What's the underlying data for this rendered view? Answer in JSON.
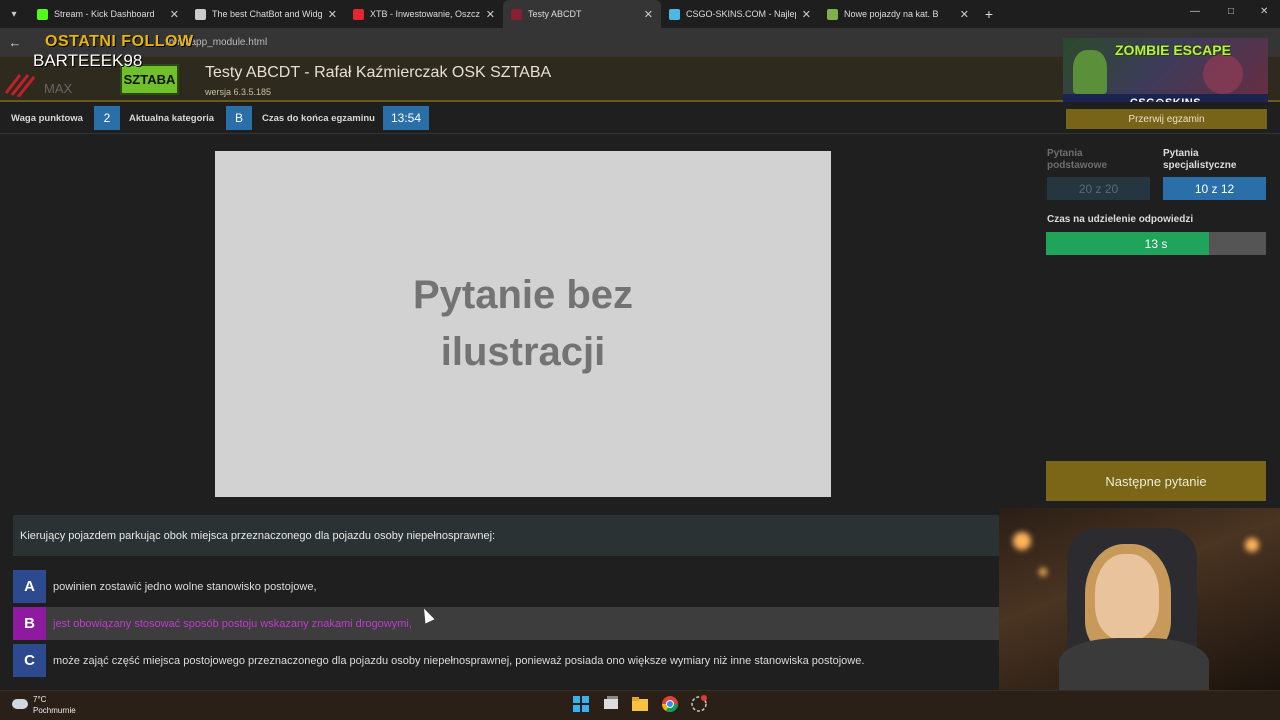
{
  "browser": {
    "tabs": [
      {
        "label": "Stream - Kick Dashboard",
        "color": "#53fc18",
        "active": false
      },
      {
        "label": "The best ChatBot and Widgets",
        "color": "#cccccc",
        "active": false
      },
      {
        "label": "XTB - Inwestowanie, Oszczędn",
        "color": "#e3262f",
        "active": false
      },
      {
        "label": "Testy ABCDT",
        "color": "#8a1f2f",
        "active": true
      },
      {
        "label": "CSGO-SKINS.COM - Najlepsze",
        "color": "#4db7e6",
        "active": false
      },
      {
        "label": "Nowe pojazdy na kat. B",
        "color": "#7fb04a",
        "active": false
      }
    ],
    "url": "/html/app_module.html"
  },
  "overlay": {
    "follow_label": "OSTATNI FOLLOW",
    "follower_name": "BARTEEEK98"
  },
  "app": {
    "logo_text": "SZTABA",
    "title": "Testy ABCDT - Rafał Kaźmierczak OSK SZTABA",
    "version": "wersja 6.3.5.185"
  },
  "promo": {
    "title": "ZOMBIE ESCAPE",
    "brand": "CSG⊙SKINS"
  },
  "info": {
    "weight_label": "Waga punktowa",
    "weight_value": "2",
    "category_label": "Aktualna kategoria",
    "category_value": "B",
    "time_label": "Czas do końca egzaminu",
    "time_value": "13:54",
    "abort_label": "Przerwij egzamin"
  },
  "question": {
    "image_text": "Pytanie bez ilustracji",
    "text": "Kierujący pojazdem parkując obok miejsca przeznaczonego dla pojazdu osoby niepełnosprawnej:",
    "answers": [
      {
        "letter": "A",
        "text": "powinien zostawić jedno wolne stanowisko postojowe,",
        "selected": false
      },
      {
        "letter": "B",
        "text": "jest obowiązany stosować sposób postoju wskazany znakami drogowymi,",
        "selected": true
      },
      {
        "letter": "C",
        "text": "może zająć część miejsca postojowego przeznaczonego dla pojazdu osoby niepełnosprawnej, ponieważ posiada ono większe wymiary niż inne stanowiska postojowe.",
        "selected": false
      }
    ]
  },
  "panel": {
    "basic_label_1": "Pytania",
    "basic_label_2": "podstawowe",
    "basic_value": "20 z 20",
    "special_label_1": "Pytania",
    "special_label_2": "specjalistyczne",
    "special_value": "10 z 12",
    "answer_time_label": "Czas na udzielenie odpowiedzi",
    "answer_time_value": "13 s",
    "answer_time_fraction": 0.74,
    "next_label": "Następne pytanie"
  },
  "taskbar": {
    "temperature": "7°C",
    "weather": "Pochmurnie"
  },
  "colors": {
    "accent_blue": "#2a6fa8",
    "gold": "#786418",
    "selected_purple": "#8e1aa0",
    "timer_green": "#20a35a"
  }
}
